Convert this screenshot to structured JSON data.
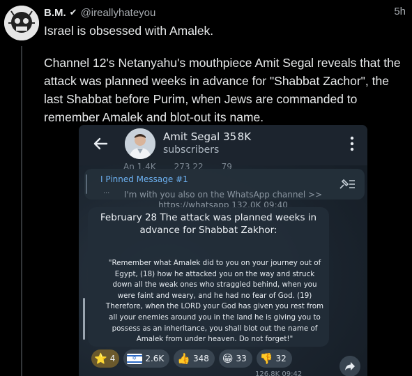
{
  "tweet": {
    "display_name": "B.M.",
    "verified_mark": "✔",
    "handle": "@ireallyhateyou",
    "time": "5h",
    "line1": "Israel is obsessed with Amalek.",
    "line2": "Channel 12's Netanyahu's mouthpiece Amit Segal reveals that the attack was planned weeks in advance for \"Shabbat Zachor\", the last Shabbat before Purim, when Jews are commanded to remember Amalek and blot-out its name."
  },
  "telegram": {
    "channel_name": "Amit Segal 35 8K",
    "subscribers_label": "subscribers",
    "ghost_row": [
      "An 1.4K",
      "273 22",
      "79"
    ],
    "pinned_title": "I Pinned Message #1",
    "pinned_dots": "...",
    "pinned_line1": "I'm with you also on the WhatsApp channel >>",
    "pinned_line2": "https://whatsapp 132.0K 09:40",
    "post_title": "February 28 The attack was planned weeks in advance for Shabbat Zakhor:",
    "quote": "\"Remember what Amalek did to you on your journey out of Egypt, (18) how he attacked you on the way and struck down all the weak ones who straggled behind, when you were faint and weary, and he had no fear of God. (19) Therefore, when the LORD your God has given you rest from all your enemies around you in the land he is giving you to possess as an inheritance, you shall blot out the name of Amalek from under heaven. Do not forget!\"",
    "reactions": [
      {
        "emoji": "⭐",
        "count": "4"
      },
      {
        "emoji": "flag",
        "count": "2.6K"
      },
      {
        "emoji": "👍",
        "count": "348"
      },
      {
        "emoji": "😁",
        "count": "33"
      },
      {
        "emoji": "👎",
        "count": "32"
      }
    ],
    "views": "126.8K 09:42"
  },
  "colors": {
    "background": "#000000",
    "text": "#e7e9ea",
    "secondary": "#a9aeb3",
    "telegram_link": "#6cb0f0"
  }
}
